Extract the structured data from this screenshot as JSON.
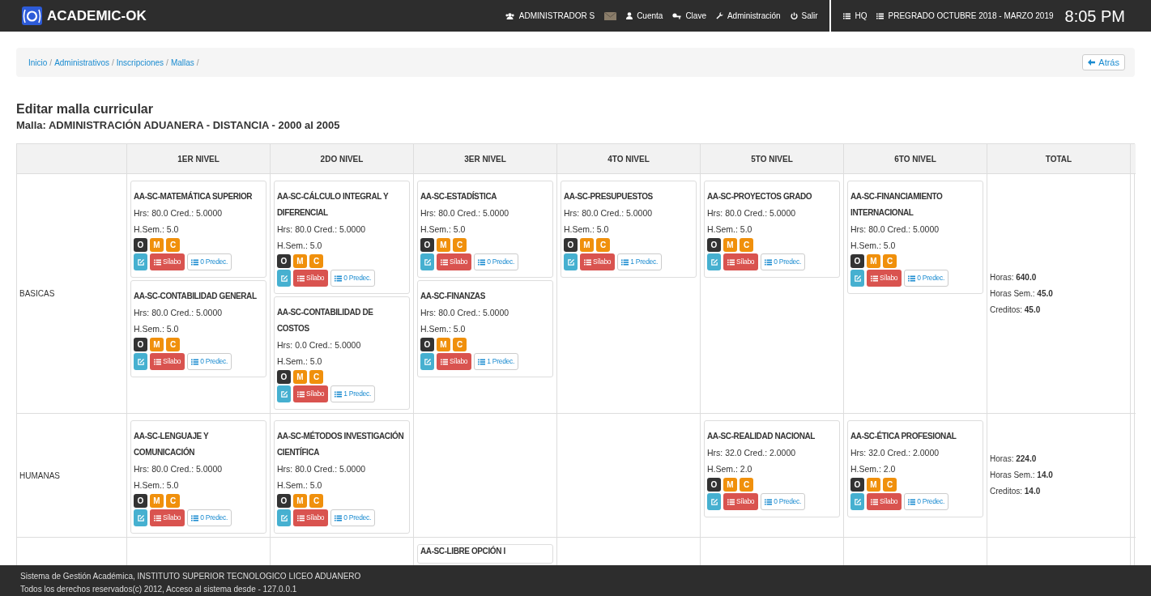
{
  "header": {
    "brand": "ACADEMIC-OK",
    "user": "ADMINISTRADOR S",
    "links": [
      {
        "kind": "user",
        "label": "Cuenta"
      },
      {
        "kind": "key",
        "label": "Clave"
      },
      {
        "kind": "wrench",
        "label": "Administración"
      },
      {
        "kind": "power",
        "label": "Salir"
      }
    ],
    "campus": "HQ",
    "period": "PREGRADO OCTUBRE 2018 - MARZO 2019",
    "clock": "8:05 PM"
  },
  "breadcrumb": [
    "Inicio",
    "Administrativos",
    "Inscripciones",
    "Mallas"
  ],
  "breadcrumb_separator": "/",
  "back_button": "Atrás",
  "page_title": "Editar malla curricular",
  "malla_title": "Malla: ADMINISTRACIÓN ADUANERA - DISTANCIA - 2000 al 2005",
  "table": {
    "columns": [
      "1ER NIVEL",
      "2DO NIVEL",
      "3ER NIVEL",
      "4TO NIVEL",
      "5TO NIVEL",
      "6TO NIVEL",
      "TOTAL"
    ],
    "rows": [
      {
        "area": "BASICAS",
        "cells": [
          [
            {
              "code": "AA-SC-MATEMÁTICA SUPERIOR",
              "hours": "Hrs: 80.0 Cred.: 5.0000",
              "weekly": "H.Sem.: 5.0",
              "tags": [
                {
                  "label": "O",
                  "color": "#333333"
                },
                {
                  "label": "M",
                  "color": "#f0900c"
                },
                {
                  "label": "C",
                  "color": "#f0900c"
                }
              ],
              "syllabus": "Sílabo",
              "prereq": "0 Predec."
            },
            {
              "code": "AA-SC-CONTABILIDAD GENERAL",
              "hours": "Hrs: 80.0 Cred.: 5.0000",
              "weekly": "H.Sem.: 5.0",
              "tags": [
                {
                  "label": "O",
                  "color": "#333333"
                },
                {
                  "label": "M",
                  "color": "#f0900c"
                },
                {
                  "label": "C",
                  "color": "#f0900c"
                }
              ],
              "syllabus": "Sílabo",
              "prereq": "0 Predec."
            }
          ],
          [
            {
              "code": "AA-SC-CÁLCULO INTEGRAL Y DIFERENCIAL",
              "hours": "Hrs: 80.0 Cred.: 5.0000",
              "weekly": "H.Sem.: 5.0",
              "tags": [
                {
                  "label": "O",
                  "color": "#333333"
                },
                {
                  "label": "M",
                  "color": "#f0900c"
                },
                {
                  "label": "C",
                  "color": "#f0900c"
                }
              ],
              "syllabus": "Sílabo",
              "prereq": "0 Predec."
            },
            {
              "code": "AA-SC-CONTABILIDAD DE COSTOS",
              "hours": "Hrs: 0.0 Cred.: 5.0000",
              "weekly": "H.Sem.: 5.0",
              "tags": [
                {
                  "label": "O",
                  "color": "#333333"
                },
                {
                  "label": "M",
                  "color": "#f0900c"
                },
                {
                  "label": "C",
                  "color": "#f0900c"
                }
              ],
              "syllabus": "Sílabo",
              "prereq": "1 Predec."
            }
          ],
          [
            {
              "code": "AA-SC-ESTADÍSTICA",
              "hours": "Hrs: 80.0 Cred.: 5.0000",
              "weekly": "H.Sem.: 5.0",
              "tags": [
                {
                  "label": "O",
                  "color": "#333333"
                },
                {
                  "label": "M",
                  "color": "#f0900c"
                },
                {
                  "label": "C",
                  "color": "#f0900c"
                }
              ],
              "syllabus": "Sílabo",
              "prereq": "0 Predec."
            },
            {
              "code": "AA-SC-FINANZAS",
              "hours": "Hrs: 80.0 Cred.: 5.0000",
              "weekly": "H.Sem.: 5.0",
              "tags": [
                {
                  "label": "O",
                  "color": "#333333"
                },
                {
                  "label": "M",
                  "color": "#f0900c"
                },
                {
                  "label": "C",
                  "color": "#f0900c"
                }
              ],
              "syllabus": "Sílabo",
              "prereq": "1 Predec."
            }
          ],
          [
            {
              "code": "AA-SC-PRESUPUESTOS",
              "hours": "Hrs: 80.0 Cred.: 5.0000",
              "weekly": "H.Sem.: 5.0",
              "tags": [
                {
                  "label": "O",
                  "color": "#333333"
                },
                {
                  "label": "M",
                  "color": "#f0900c"
                },
                {
                  "label": "C",
                  "color": "#f0900c"
                }
              ],
              "syllabus": "Sílabo",
              "prereq": "1 Predec."
            }
          ],
          [
            {
              "code": "AA-SC-PROYECTOS GRADO",
              "hours": "Hrs: 80.0 Cred.: 5.0000",
              "weekly": "H.Sem.: 5.0",
              "tags": [
                {
                  "label": "O",
                  "color": "#333333"
                },
                {
                  "label": "M",
                  "color": "#f0900c"
                },
                {
                  "label": "C",
                  "color": "#f0900c"
                }
              ],
              "syllabus": "Sílabo",
              "prereq": "0 Predec."
            }
          ],
          [
            {
              "code": "AA-SC-FINANCIAMIENTO INTERNACIONAL",
              "hours": "Hrs: 80.0 Cred.: 5.0000",
              "weekly": "H.Sem.: 5.0",
              "tags": [
                {
                  "label": "O",
                  "color": "#333333"
                },
                {
                  "label": "M",
                  "color": "#f0900c"
                },
                {
                  "label": "C",
                  "color": "#f0900c"
                }
              ],
              "syllabus": "Sílabo",
              "prereq": "0 Predec."
            }
          ]
        ],
        "totals": [
          {
            "label": "Horas:",
            "value": "640.0"
          },
          {
            "label": "Horas Sem.:",
            "value": "45.0"
          },
          {
            "label": "Creditos:",
            "value": "45.0"
          }
        ]
      },
      {
        "area": "HUMANAS",
        "cells": [
          [
            {
              "code": "AA-SC-LENGUAJE Y COMUNICACIÓN",
              "hours": "Hrs: 80.0 Cred.: 5.0000",
              "weekly": "H.Sem.: 5.0",
              "tags": [
                {
                  "label": "O",
                  "color": "#333333"
                },
                {
                  "label": "M",
                  "color": "#f0900c"
                },
                {
                  "label": "C",
                  "color": "#f0900c"
                }
              ],
              "syllabus": "Sílabo",
              "prereq": "0 Predec."
            }
          ],
          [
            {
              "code": "AA-SC-MÉTODOS INVESTIGACIÓN CIENTÍFICA",
              "hours": "Hrs: 80.0 Cred.: 5.0000",
              "weekly": "H.Sem.: 5.0",
              "tags": [
                {
                  "label": "O",
                  "color": "#333333"
                },
                {
                  "label": "M",
                  "color": "#f0900c"
                },
                {
                  "label": "C",
                  "color": "#f0900c"
                }
              ],
              "syllabus": "Sílabo",
              "prereq": "0 Predec."
            }
          ],
          [],
          [],
          [
            {
              "code": "AA-SC-REALIDAD NACIONAL",
              "hours": "Hrs: 32.0 Cred.: 2.0000",
              "weekly": "H.Sem.: 2.0",
              "tags": [
                {
                  "label": "O",
                  "color": "#333333"
                },
                {
                  "label": "M",
                  "color": "#f0900c"
                },
                {
                  "label": "C",
                  "color": "#f0900c"
                }
              ],
              "syllabus": "Sílabo",
              "prereq": "0 Predec."
            }
          ],
          [
            {
              "code": "AA-SC-ÉTICA PROFESIONAL",
              "hours": "Hrs: 32.0 Cred.: 2.0000",
              "weekly": "H.Sem.: 2.0",
              "tags": [
                {
                  "label": "O",
                  "color": "#333333"
                },
                {
                  "label": "M",
                  "color": "#f0900c"
                },
                {
                  "label": "C",
                  "color": "#f0900c"
                }
              ],
              "syllabus": "Sílabo",
              "prereq": "0 Predec."
            }
          ]
        ],
        "totals": [
          {
            "label": "Horas:",
            "value": "224.0"
          },
          {
            "label": "Horas Sem.:",
            "value": "14.0"
          },
          {
            "label": "Creditos:",
            "value": "14.0"
          }
        ]
      },
      {
        "cells": [
          [],
          [],
          [
            {
              "code": "AA-SC-LIBRE OPCIÓN I"
            }
          ],
          [],
          [],
          []
        ]
      }
    ]
  },
  "footer": [
    "Sistema de Gestión Académica, INSTITUTO SUPERIOR TECNOLOGICO LICEO ADUANERO",
    "Todos los derechos reservados(c) 2012, Acceso al sistema desde - 127.0.0.1"
  ]
}
